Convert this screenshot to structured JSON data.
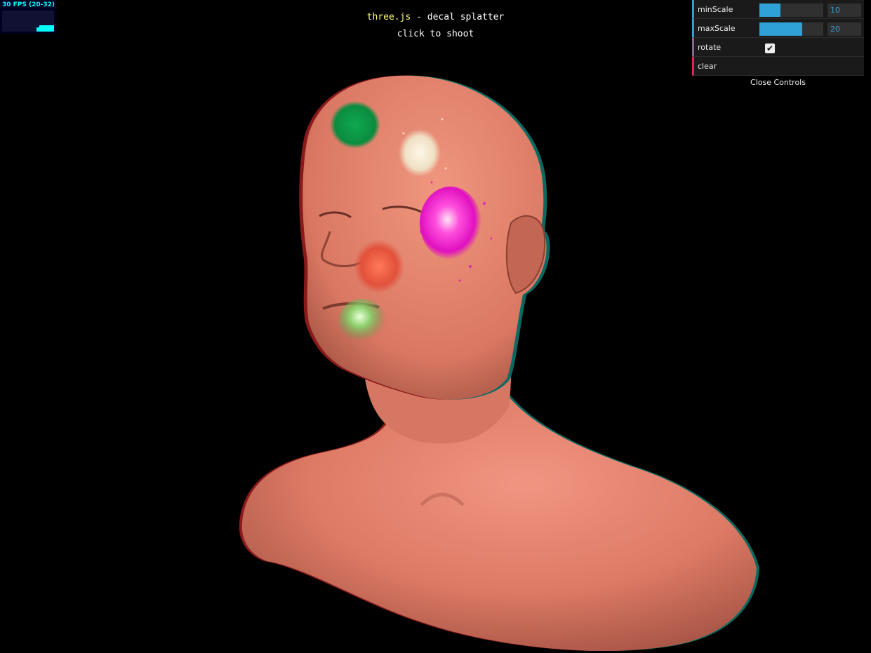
{
  "header": {
    "link_text": "three.js",
    "title_rest": " - decal splatter",
    "subtitle": "click to shoot"
  },
  "stats": {
    "fps_text": "30 FPS (20-32)"
  },
  "gui": {
    "controls": [
      {
        "label": "minScale",
        "type": "number",
        "value": "10",
        "fill": 0.33
      },
      {
        "label": "maxScale",
        "type": "number",
        "value": "20",
        "fill": 0.67
      },
      {
        "label": "rotate",
        "type": "boolean",
        "checked": true
      },
      {
        "label": "clear",
        "type": "function"
      }
    ],
    "close_label": "Close Controls"
  },
  "colors": {
    "background": "#000000",
    "skin": "#e8826e",
    "link": "#ffff80",
    "gui_number_accent": "#2fa1d6",
    "gui_boolean_accent": "#806787",
    "gui_function_accent": "#e61d5f",
    "stats_text": "#00ffff",
    "decal_green": "#0c9a48",
    "decal_cream": "#f4e8d2",
    "decal_magenta": "#ff1ed2",
    "decal_red": "#f05a3c",
    "decal_lightgreen": "#8acb6a"
  },
  "icons": {
    "checkbox_tick": "check-icon"
  }
}
